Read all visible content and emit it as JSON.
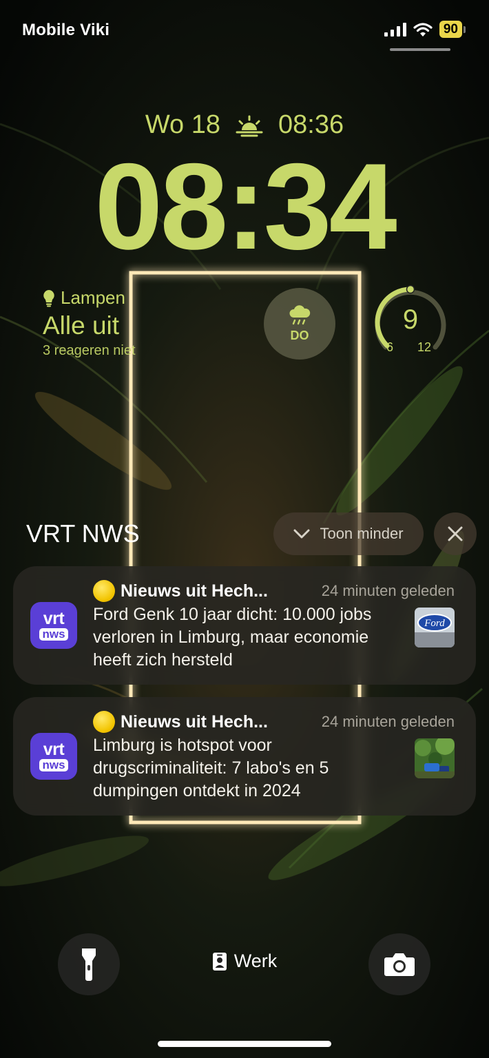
{
  "status_bar": {
    "carrier": "Mobile Viki",
    "battery_level": "90",
    "signal_bars": 4,
    "wifi": "full"
  },
  "lock_screen": {
    "date": "Wo 18",
    "sunrise_time": "08:36",
    "time": "08:34",
    "accent_color": "#c7d86a"
  },
  "widgets": {
    "lamps": {
      "title": "Lampen",
      "status": "Alle uit",
      "subtitle": "3 reageren niet"
    },
    "weather": {
      "icon": "rain-cloud-icon",
      "day": "DO"
    },
    "temperature": {
      "value": "9",
      "min": "6",
      "max": "12",
      "level_fraction": 0.5
    }
  },
  "notification_group": {
    "app_name": "VRT NWS",
    "show_less_label": "Toon minder"
  },
  "notifications": [
    {
      "app_icon_top": "vrt",
      "app_icon_bottom": "nws",
      "title": "Nieuws uit Hech...",
      "time": "24 minuten geleden",
      "body": "Ford Genk 10 jaar dicht: 10.000 jobs verloren in Limburg, maar economie heeft zich hersteld"
    },
    {
      "app_icon_top": "vrt",
      "app_icon_bottom": "nws",
      "title": "Nieuws uit Hech...",
      "time": "24 minuten geleden",
      "body": "Limburg is hotspot voor drugscriminaliteit: 7 labo's en 5 dumpingen ontdekt in 2024"
    }
  ],
  "bottom_bar": {
    "focus_label": "Werk"
  }
}
